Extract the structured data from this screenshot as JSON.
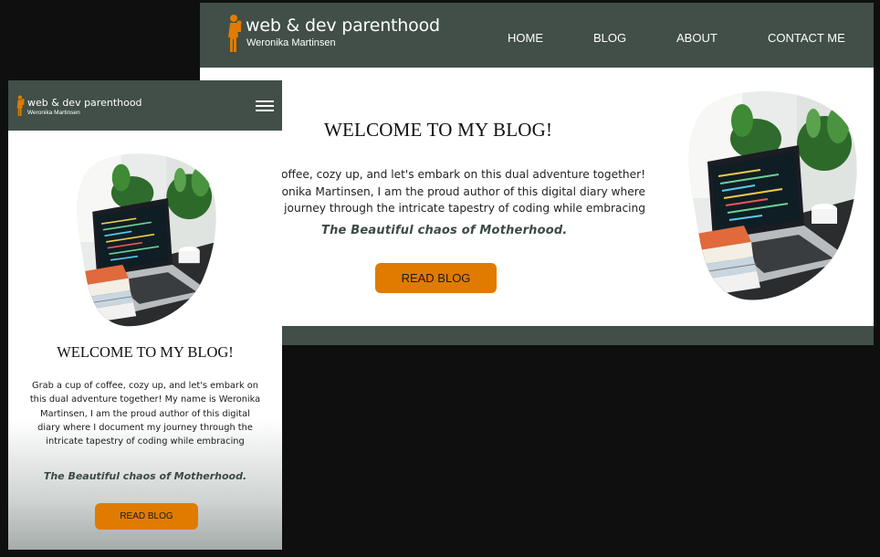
{
  "brand": {
    "title": "web & dev parenthood",
    "subtitle": "Weronika Martinsen",
    "accent_color": "#e07b00",
    "header_color": "#414f48",
    "logo_icon": "parent-with-child-icon"
  },
  "desktop": {
    "nav": {
      "home": "HOME",
      "blog": "BLOG",
      "about": "ABOUT",
      "contact": "CONTACT ME"
    },
    "hero": {
      "heading": "WELCOME TO MY BLOG!",
      "line1": "p of coffee, cozy up, and let's embark on this dual adventure together!",
      "line2": "s Weronika Martinsen, I am the proud author of this digital diary where",
      "line3": "nt my journey through the intricate tapestry of coding while embracing",
      "tagline": "The Beautiful chaos of Motherhood.",
      "button": "READ BLOG",
      "image": "laptop-with-books-and-plants"
    }
  },
  "mobile": {
    "menu_icon": "hamburger-menu-icon",
    "hero": {
      "heading": "WELCOME TO MY BLOG!",
      "paragraph": "Grab a cup of coffee, cozy up, and let's embark on this dual adventure together! My name is Weronika Martinsen, I am the proud author of this digital diary where I document my journey through the intricate tapestry of coding while embracing",
      "tagline": "The Beautiful chaos of Motherhood.",
      "button": "READ BLOG",
      "image": "laptop-with-books-and-plants"
    }
  }
}
